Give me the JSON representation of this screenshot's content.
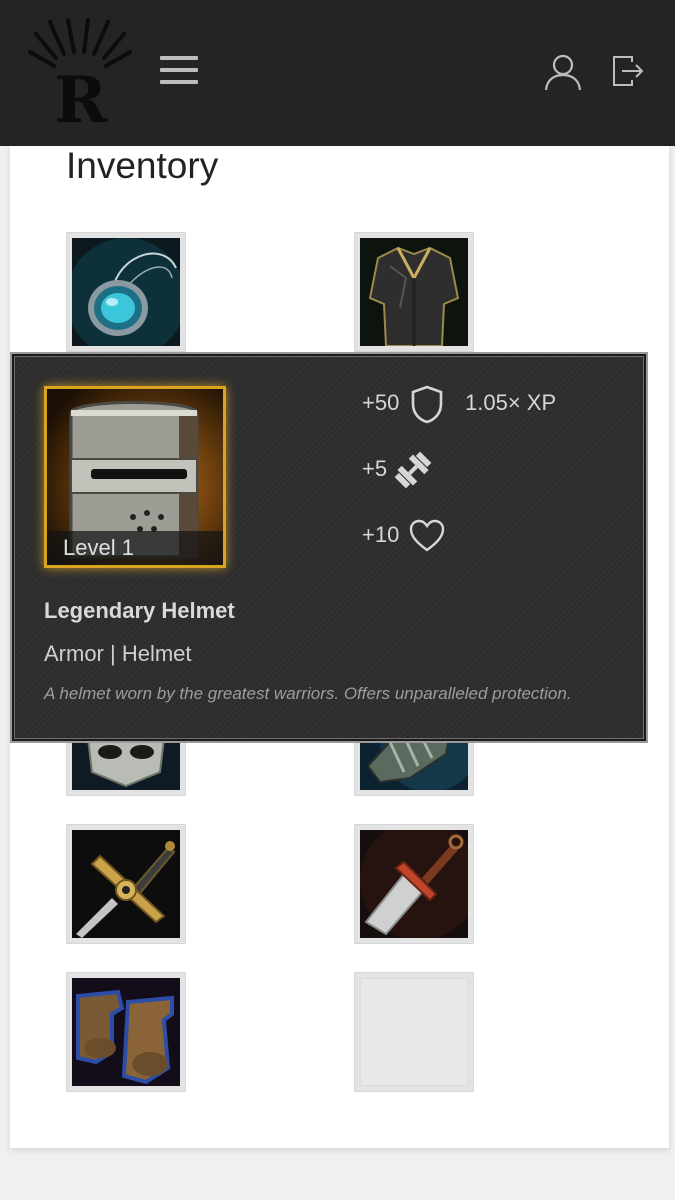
{
  "header": {
    "logo_icon": "r-crown-logo",
    "menu_icon": "hamburger-icon",
    "user_icon": "user-icon",
    "logout_icon": "logout-icon",
    "background": "#242424"
  },
  "page": {
    "title": "Inventory"
  },
  "inventory": {
    "slots": [
      {
        "icon": "amulet-icon"
      },
      {
        "icon": "chest-armor-icon"
      },
      {
        "icon": "iron-mask-icon"
      },
      {
        "icon": "gauntlet-icon"
      },
      {
        "icon": "golden-sword-icon"
      },
      {
        "icon": "red-dagger-icon"
      },
      {
        "icon": "boots-icon"
      },
      {
        "icon": "empty-slot"
      }
    ]
  },
  "tooltip": {
    "item_icon": "knight-helmet-icon",
    "level": "Level 1",
    "rarity_color": "#d9a520",
    "stats": {
      "armor": "+50",
      "armor_icon": "shield-icon",
      "xp": "1.05× XP",
      "strength": "+5",
      "strength_icon": "dumbbell-icon",
      "health": "+10",
      "health_icon": "heart-icon"
    },
    "name": "Legendary Helmet",
    "type": "Armor | Helmet",
    "description": "A helmet worn by the greatest warriors. Offers unparalleled protection."
  }
}
